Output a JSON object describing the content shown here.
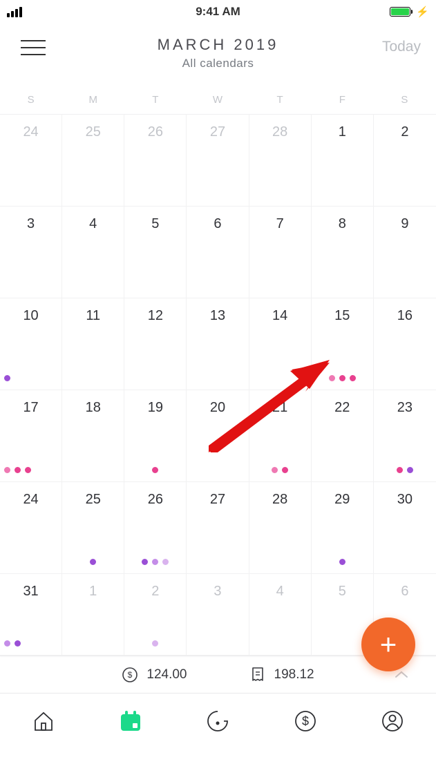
{
  "status": {
    "time": "9:41 AM"
  },
  "header": {
    "title": "MARCH 2019",
    "subtitle": "All calendars",
    "today": "Today"
  },
  "weekdays": [
    "S",
    "M",
    "T",
    "W",
    "T",
    "F",
    "S"
  ],
  "cells": [
    {
      "n": "24",
      "muted": true,
      "dots": []
    },
    {
      "n": "25",
      "muted": true,
      "dots": []
    },
    {
      "n": "26",
      "muted": true,
      "dots": []
    },
    {
      "n": "27",
      "muted": true,
      "dots": []
    },
    {
      "n": "28",
      "muted": true,
      "dots": []
    },
    {
      "n": "1",
      "muted": false,
      "dots": []
    },
    {
      "n": "2",
      "muted": false,
      "dots": []
    },
    {
      "n": "3",
      "muted": false,
      "dots": []
    },
    {
      "n": "4",
      "muted": false,
      "dots": []
    },
    {
      "n": "5",
      "muted": false,
      "dots": []
    },
    {
      "n": "6",
      "muted": false,
      "dots": []
    },
    {
      "n": "7",
      "muted": false,
      "dots": []
    },
    {
      "n": "8",
      "muted": false,
      "dots": []
    },
    {
      "n": "9",
      "muted": false,
      "dots": []
    },
    {
      "n": "10",
      "muted": false,
      "dots": [
        "purple"
      ]
    },
    {
      "n": "11",
      "muted": false,
      "dots": []
    },
    {
      "n": "12",
      "muted": false,
      "dots": []
    },
    {
      "n": "13",
      "muted": false,
      "dots": []
    },
    {
      "n": "14",
      "muted": false,
      "dots": []
    },
    {
      "n": "15",
      "muted": false,
      "dots": [
        "pinklt",
        "pink",
        "pink"
      ]
    },
    {
      "n": "16",
      "muted": false,
      "dots": []
    },
    {
      "n": "17",
      "muted": false,
      "dots": [
        "pinklt",
        "pink",
        "pink"
      ]
    },
    {
      "n": "18",
      "muted": false,
      "dots": []
    },
    {
      "n": "19",
      "muted": false,
      "dots": [
        "pink"
      ]
    },
    {
      "n": "20",
      "muted": false,
      "dots": []
    },
    {
      "n": "21",
      "muted": false,
      "dots": [
        "pinklt",
        "pink"
      ]
    },
    {
      "n": "22",
      "muted": false,
      "dots": []
    },
    {
      "n": "23",
      "muted": false,
      "dots": [
        "pink",
        "purple"
      ]
    },
    {
      "n": "24",
      "muted": false,
      "dots": []
    },
    {
      "n": "25",
      "muted": false,
      "dots": [
        "purple"
      ]
    },
    {
      "n": "26",
      "muted": false,
      "dots": [
        "purple",
        "purplelt",
        "lav"
      ]
    },
    {
      "n": "27",
      "muted": false,
      "dots": []
    },
    {
      "n": "28",
      "muted": false,
      "dots": []
    },
    {
      "n": "29",
      "muted": false,
      "dots": [
        "purple"
      ]
    },
    {
      "n": "30",
      "muted": false,
      "dots": []
    },
    {
      "n": "31",
      "muted": false,
      "dots": [
        "purplelt",
        "purple"
      ]
    },
    {
      "n": "1",
      "muted": true,
      "dots": []
    },
    {
      "n": "2",
      "muted": true,
      "dots": [
        "lav"
      ]
    },
    {
      "n": "3",
      "muted": true,
      "dots": []
    },
    {
      "n": "4",
      "muted": true,
      "dots": []
    },
    {
      "n": "5",
      "muted": true,
      "dots": []
    },
    {
      "n": "6",
      "muted": true,
      "dots": []
    }
  ],
  "summary": {
    "income": "124.00",
    "expense": "198.12"
  },
  "fab_label": "+"
}
